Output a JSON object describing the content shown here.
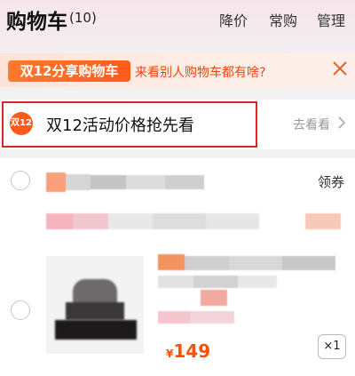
{
  "header": {
    "title": "购物车",
    "count": "(10)",
    "actions": [
      "降价",
      "常购",
      "管理"
    ]
  },
  "banner": {
    "badge": "双12分享购物车",
    "text": "来看别人购物车都有啥?"
  },
  "activity": {
    "logo_text": "双12",
    "title": "双12活动价格抢先看",
    "more": "去看看"
  },
  "shop": {
    "coupon_label": "领券",
    "item": {
      "price_symbol": "¥",
      "price": "149",
      "quantity": "×1"
    }
  },
  "colors": {
    "accent": "#ff5000",
    "highlight_border": "#d8262a",
    "banner_text": "#f0450f"
  }
}
